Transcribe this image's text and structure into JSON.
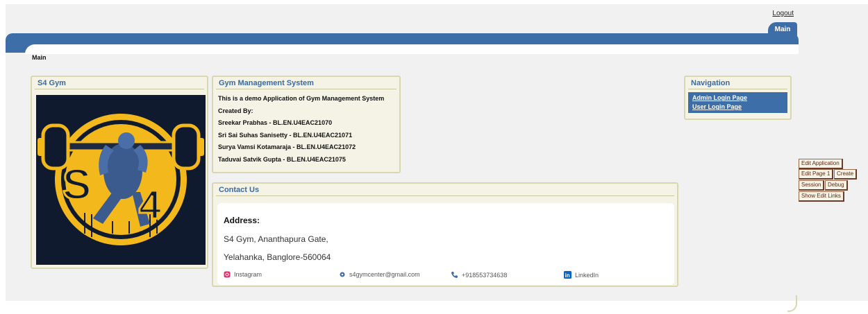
{
  "header": {
    "logout_label": "Logout",
    "tab_main": "Main",
    "breadcrumb": "Main"
  },
  "s4_region": {
    "title": "S4 Gym",
    "logo_text": "S4"
  },
  "gym_region": {
    "title": "Gym Management System",
    "lines": [
      "This is a demo Application of Gym Management System",
      "Created By:",
      "Sreekar Prabhas - BL.EN.U4EAC21070",
      "Sri Sai Suhas Sanisetty - BL.EN.U4EAC21071",
      "Surya Vamsi Kotamaraja - BL.EN.U4EAC21072",
      "Taduvai Satvik Gupta - BL.EN.U4EAC21075"
    ]
  },
  "contact_region": {
    "title": "Contact Us",
    "address_heading": "Address:",
    "address_line1": "S4 Gym, Ananthapura Gate,",
    "address_line2": "Yelahanka, Banglore-560064",
    "instagram": "Instagram",
    "email": "s4gymcenter@gmail.com",
    "phone": "+918553734638",
    "linkedin": "LinkedIn"
  },
  "nav_region": {
    "title": "Navigation",
    "items": [
      "Admin Login Page",
      "User Login Page"
    ]
  },
  "dev_toolbar": {
    "edit_application": "Edit Application",
    "edit_page": "Edit Page 1",
    "create": "Create",
    "session": "Session",
    "debug": "Debug",
    "show_edit_links": "Show Edit Links"
  },
  "colors": {
    "accent": "#3e6ea8",
    "region_bg": "#f4f3e5",
    "logo_bg": "#0f1a2e",
    "logo_gold": "#f2b81c"
  }
}
